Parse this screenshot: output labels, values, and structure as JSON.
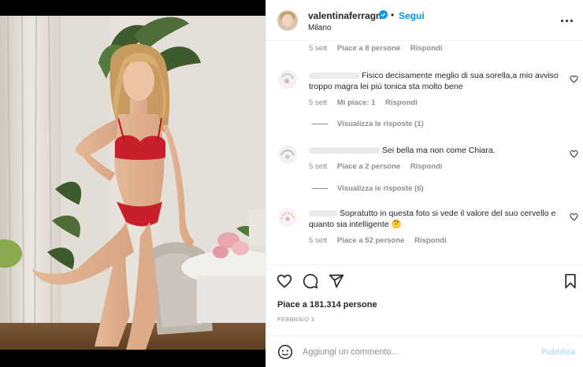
{
  "header": {
    "username": "valentinaferragni",
    "separator": "•",
    "follow_label": "Segui",
    "location": "Milano"
  },
  "comments": {
    "top_meta": {
      "time": "5 sett",
      "likes": "Piace a 8 persone",
      "reply": "Rispondi"
    },
    "items": [
      {
        "text": "Fisico decisamente meglio di sua sorella,a mio avviso troppo magra lei più tonica sta molto bene",
        "time": "5 sett",
        "likes": "Mi piace: 1",
        "reply": "Rispondi",
        "view_replies": "Visualizza le risposte (1)"
      },
      {
        "text": "Sei bella ma non come Chiara.",
        "time": "5 sett",
        "likes": "Piace a 2 persone",
        "reply": "Rispondi",
        "view_replies": "Visualizza le risposte (6)"
      },
      {
        "text": "Sopratutto in questa foto si vede il valore del suo cervello e quanto sia intelligente",
        "emoji": "🤔",
        "time": "5 sett",
        "likes": "Piace a 52 persone",
        "reply": "Rispondi"
      }
    ]
  },
  "actions": {
    "likes_text": "Piace a 181.314 persone",
    "date": "FEBBRAIO 3"
  },
  "add_comment": {
    "placeholder": "Aggiungi un commento...",
    "publish_label": "Pubblica"
  },
  "colors": {
    "accent": "#0095f6",
    "muted": "#8e8e8e",
    "text": "#262626",
    "publish_disabled": "#b2dffc",
    "lingerie": "#c8202b"
  },
  "icons": [
    "verified-badge-icon",
    "more-options-icon",
    "heart-icon",
    "comment-icon",
    "share-icon",
    "save-icon",
    "emoji-icon"
  ]
}
